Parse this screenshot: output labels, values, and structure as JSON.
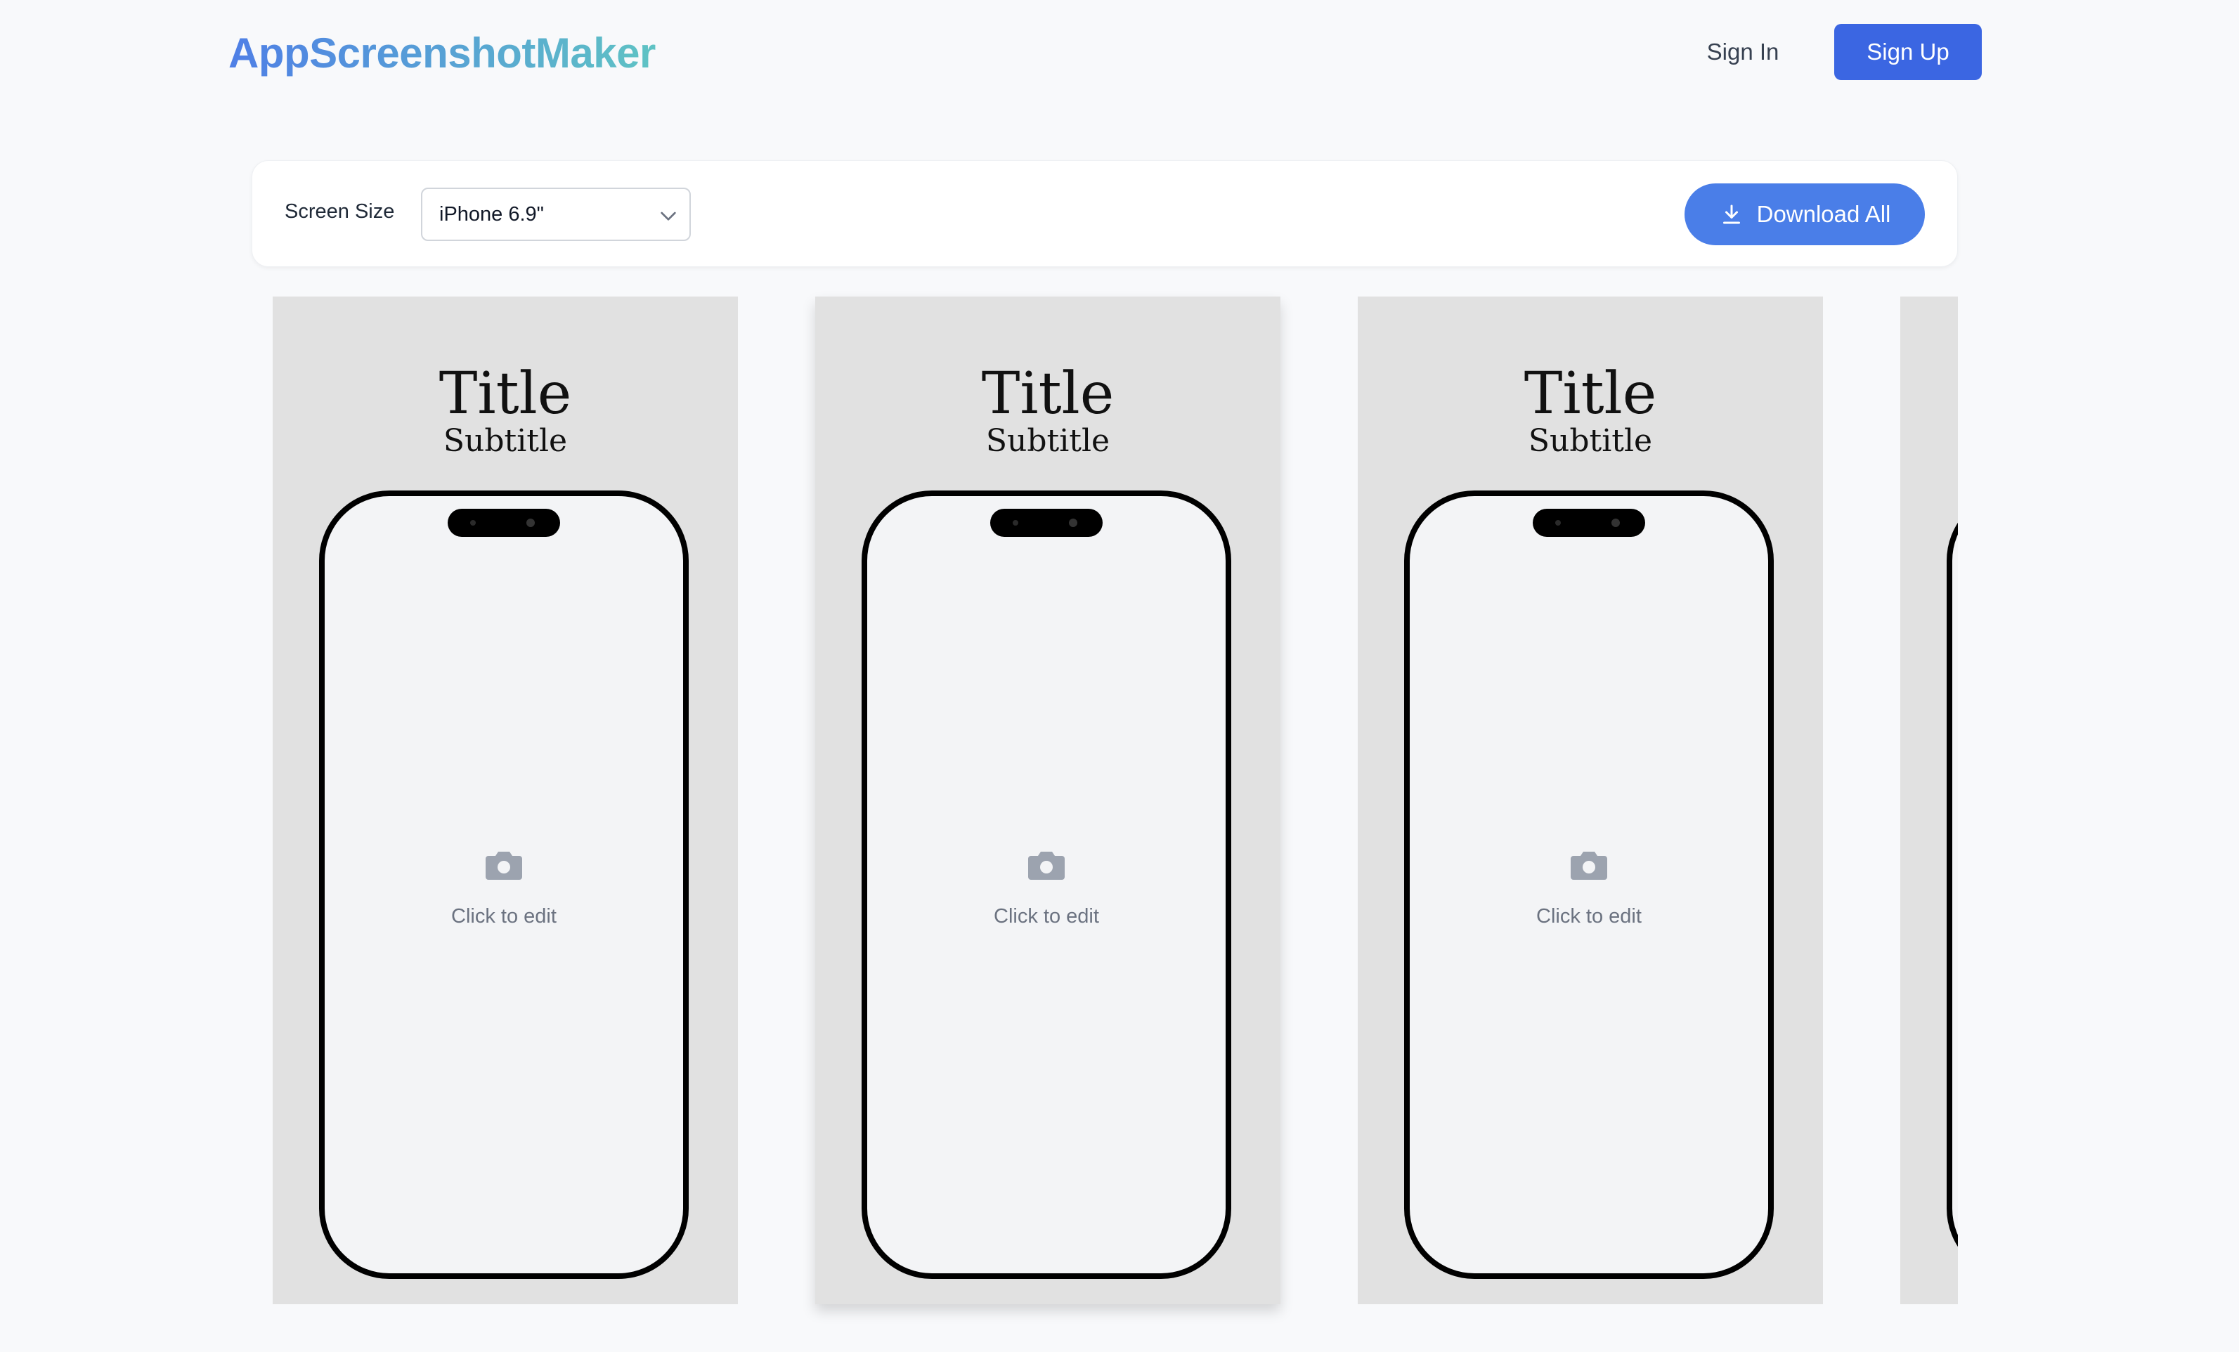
{
  "header": {
    "logo": "AppScreenshotMaker",
    "sign_in": "Sign In",
    "sign_up": "Sign Up"
  },
  "toolbar": {
    "screen_size_label": "Screen Size",
    "screen_size_value": "iPhone 6.9\"",
    "download_all": "Download All"
  },
  "cards": [
    {
      "title": "Title",
      "subtitle": "Subtitle",
      "placeholder": "Click to edit"
    },
    {
      "title": "Title",
      "subtitle": "Subtitle",
      "placeholder": "Click to edit"
    },
    {
      "title": "Title",
      "subtitle": "Subtitle",
      "placeholder": "Click to edit"
    }
  ],
  "colors": {
    "primary": "#3b66e2",
    "download": "#4a7ee8",
    "card_bg": "#e1e1e1",
    "logo_gradient": [
      "#4f7fe6",
      "#5fc3c4"
    ]
  },
  "icons": [
    "download-icon",
    "chevron-down-icon",
    "camera-icon"
  ]
}
